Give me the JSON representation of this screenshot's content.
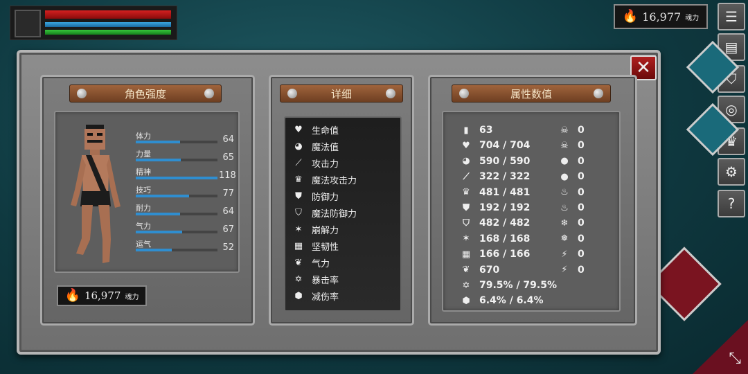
{
  "hud": {
    "hp_fraction": 1.0,
    "mp_fraction": 1.0,
    "stamina_fraction": 1.0
  },
  "souls": {
    "value": "16,977",
    "unit": "魂力",
    "icon": "flame-icon"
  },
  "side_menu": [
    {
      "name": "menu-icon",
      "glyph": "☰"
    },
    {
      "name": "inventory-icon",
      "glyph": "▤"
    },
    {
      "name": "helmet-icon",
      "glyph": "⛉"
    },
    {
      "name": "spiral-icon",
      "glyph": "◎"
    },
    {
      "name": "crown-icon",
      "glyph": "♛"
    },
    {
      "name": "gear-icon",
      "glyph": "⚙"
    },
    {
      "name": "help-icon",
      "glyph": "?"
    }
  ],
  "close_glyph": "✕",
  "character_panel": {
    "title": "角色强度",
    "stats": [
      {
        "label": "体力",
        "value": "64",
        "fraction": 0.54
      },
      {
        "label": "力量",
        "value": "65",
        "fraction": 0.55
      },
      {
        "label": "精神",
        "value": "118",
        "fraction": 1.0
      },
      {
        "label": "技巧",
        "value": "77",
        "fraction": 0.65
      },
      {
        "label": "耐力",
        "value": "64",
        "fraction": 0.54
      },
      {
        "label": "气力",
        "value": "67",
        "fraction": 0.57
      },
      {
        "label": "运气",
        "value": "52",
        "fraction": 0.44
      }
    ]
  },
  "details_panel": {
    "title": "详细",
    "items": [
      {
        "label": "生命值",
        "icon": "heart-icon",
        "glyph": "♥"
      },
      {
        "label": "魔法值",
        "icon": "brain-icon",
        "glyph": "◕"
      },
      {
        "label": "攻击力",
        "icon": "sword-icon",
        "glyph": "⟋"
      },
      {
        "label": "魔法攻击力",
        "icon": "crown-spell-icon",
        "glyph": "♛"
      },
      {
        "label": "防御力",
        "icon": "shield-icon",
        "glyph": "⛊"
      },
      {
        "label": "魔法防御力",
        "icon": "magic-shield-icon",
        "glyph": "⛉"
      },
      {
        "label": "崩解力",
        "icon": "break-icon",
        "glyph": "✶"
      },
      {
        "label": "坚韧性",
        "icon": "toughness-icon",
        "glyph": "▦"
      },
      {
        "label": "气力",
        "icon": "lungs-icon",
        "glyph": "❦"
      },
      {
        "label": "暴击率",
        "icon": "star-icon",
        "glyph": "✡"
      },
      {
        "label": "减伤率",
        "icon": "badge-icon",
        "glyph": "⬢"
      }
    ]
  },
  "attributes_panel": {
    "title": "属性数值",
    "left_values": [
      {
        "value": "63",
        "icon": "level-icon",
        "glyph": "▮"
      },
      {
        "value": "704 / 704",
        "icon": "heart-icon",
        "glyph": "♥"
      },
      {
        "value": "590 / 590",
        "icon": "brain-icon",
        "glyph": "◕"
      },
      {
        "value": "322 / 322",
        "icon": "sword-icon",
        "glyph": "⟋"
      },
      {
        "value": "481 / 481",
        "icon": "crown-spell-icon",
        "glyph": "♛"
      },
      {
        "value": "192 / 192",
        "icon": "shield-icon",
        "glyph": "⛊"
      },
      {
        "value": "482 / 482",
        "icon": "magic-shield-icon",
        "glyph": "⛉"
      },
      {
        "value": "168 / 168",
        "icon": "break-icon",
        "glyph": "✶"
      },
      {
        "value": "166 / 166",
        "icon": "toughness-icon",
        "glyph": "▦"
      },
      {
        "value": "670",
        "icon": "lungs-icon",
        "glyph": "❦"
      },
      {
        "value": "79.5% / 79.5%",
        "icon": "star-icon",
        "glyph": "✡"
      },
      {
        "value": "6.4% / 6.4%",
        "icon": "badge-icon",
        "glyph": "⬢"
      }
    ],
    "right_values": [
      {
        "value": "0",
        "icon": "skull-icon",
        "glyph": "☠"
      },
      {
        "value": "0",
        "icon": "skull-crossed-icon",
        "glyph": "☠"
      },
      {
        "value": "0",
        "icon": "drop-icon",
        "glyph": "●"
      },
      {
        "value": "0",
        "icon": "drop-crossed-icon",
        "glyph": "●"
      },
      {
        "value": "0",
        "icon": "fire-icon",
        "glyph": "♨"
      },
      {
        "value": "0",
        "icon": "fire-crossed-icon",
        "glyph": "♨"
      },
      {
        "value": "0",
        "icon": "snowflake-icon",
        "glyph": "❄"
      },
      {
        "value": "0",
        "icon": "snowflake-crossed-icon",
        "glyph": "❅"
      },
      {
        "value": "0",
        "icon": "lightning-icon",
        "glyph": "⚡"
      },
      {
        "value": "0",
        "icon": "lightning-crossed-icon",
        "glyph": "⚡"
      }
    ]
  }
}
